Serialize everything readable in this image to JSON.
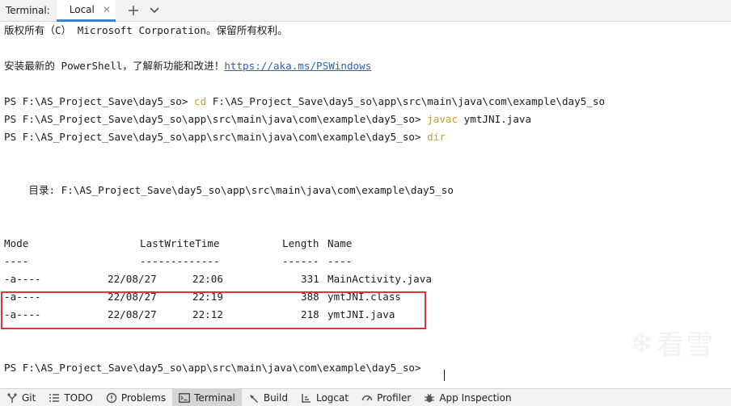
{
  "tabbar": {
    "title": "Terminal:",
    "tab_label": "Local",
    "close_icon": "close-icon",
    "add_icon": "plus-icon",
    "dropdown_icon": "chevron-down-icon"
  },
  "terminal": {
    "copyright": "版权所有（C） Microsoft Corporation。保留所有权利。",
    "install_text": "安装最新的 PowerShell，了解新功能和改进！",
    "install_link": "https://aka.ms/PSWindows",
    "prompt1": "PS F:\\AS_Project_Save\\day5_so> ",
    "cmd1": "cd",
    "cmd1_args": " F:\\AS_Project_Save\\day5_so\\app\\src\\main\\java\\com\\example\\day5_so",
    "prompt2": "PS F:\\AS_Project_Save\\day5_so\\app\\src\\main\\java\\com\\example\\day5_so> ",
    "cmd2": "javac",
    "cmd2_args": " ymtJNI.java",
    "prompt3": "PS F:\\AS_Project_Save\\day5_so\\app\\src\\main\\java\\com\\example\\day5_so> ",
    "cmd3": "dir",
    "directory": "    目录: F:\\AS_Project_Save\\day5_so\\app\\src\\main\\java\\com\\example\\day5_so",
    "headers": {
      "mode": "Mode",
      "time": "LastWriteTime",
      "length": "Length",
      "name": "Name"
    },
    "separators": {
      "mode": "----",
      "time": "-------------",
      "length": "------",
      "name": "----"
    },
    "rows": [
      {
        "mode": "-a----",
        "date": "22/08/27",
        "time": "22:06",
        "length": "331",
        "name": "MainActivity.java"
      },
      {
        "mode": "-a----",
        "date": "22/08/27",
        "time": "22:19",
        "length": "388",
        "name": "ymtJNI.class"
      },
      {
        "mode": "-a----",
        "date": "22/08/27",
        "time": "22:12",
        "length": "218",
        "name": "ymtJNI.java"
      }
    ],
    "final_prompt": "PS F:\\AS_Project_Save\\day5_so\\app\\src\\main\\java\\com\\example\\day5_so> "
  },
  "watermark": {
    "text": "看雪",
    "icon": "snowflake-icon"
  },
  "toolwindows": [
    {
      "label": "Git",
      "icon": "git-branch-icon"
    },
    {
      "label": "TODO",
      "icon": "list-icon"
    },
    {
      "label": "Problems",
      "icon": "problems-icon"
    },
    {
      "label": "Terminal",
      "icon": "terminal-icon"
    },
    {
      "label": "Build",
      "icon": "hammer-icon"
    },
    {
      "label": "Logcat",
      "icon": "logcat-icon"
    },
    {
      "label": "Profiler",
      "icon": "gauge-icon"
    },
    {
      "label": "App Inspection",
      "icon": "bug-icon"
    }
  ],
  "colors": {
    "command": "#c9a227",
    "link": "#2a62b8",
    "highlight_border": "#e0333a",
    "tab_accent": "#4083c9"
  }
}
